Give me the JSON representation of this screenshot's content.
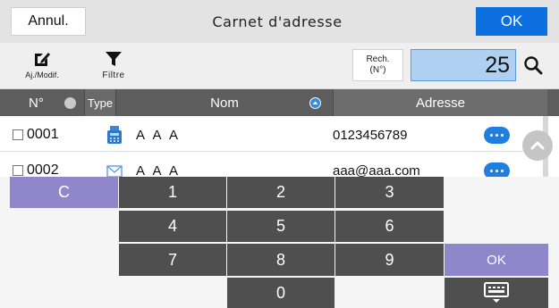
{
  "header": {
    "cancel_label": "Annul.",
    "title": "Carnet d'adresse",
    "ok_label": "OK"
  },
  "toolbar": {
    "edit_label": "Aj./Modif.",
    "filter_label": "Filtre",
    "search_type_line1": "Rech.",
    "search_type_line2": "(N°)",
    "search_value": "25"
  },
  "columns": {
    "number": "N°",
    "type": "Type",
    "name": "Nom",
    "address": "Adresse"
  },
  "rows": [
    {
      "number": "0001",
      "type_icon": "fax-icon",
      "name": "A A A",
      "address": "0123456789"
    },
    {
      "number": "0002",
      "type_icon": "email-icon",
      "name": "A A A",
      "address": "aaa@aaa.com"
    }
  ],
  "keypad": {
    "clear": "C",
    "digits": [
      "1",
      "2",
      "3",
      "4",
      "5",
      "6",
      "7",
      "8",
      "9",
      "0"
    ],
    "ok": "OK",
    "keyboard_icon": "keyboard-icon"
  },
  "colors": {
    "accent_blue": "#0b6fe0",
    "search_field_bg": "#aed0f2",
    "header_dark": "#5d5d5d",
    "key_dark": "#4f4f4f",
    "key_purple": "#8f87c9"
  }
}
